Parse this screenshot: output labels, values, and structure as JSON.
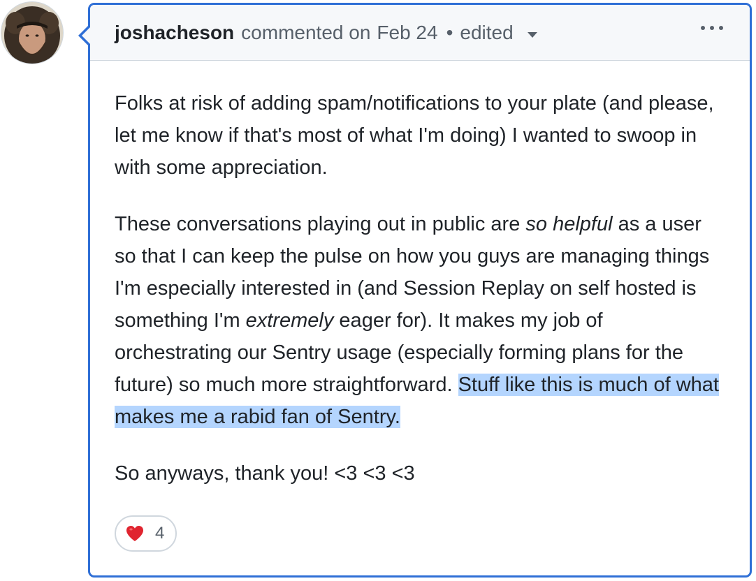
{
  "comment": {
    "author": "joshacheson",
    "action": "commented on",
    "date": "Feb 24",
    "separator": "•",
    "edited_label": "edited",
    "avatar_icon": "user-avatar",
    "menu_icon": "kebab-horizontal-icon",
    "paragraphs": {
      "p1": "Folks at risk of adding spam/notifications to your plate (and please, let me know if that's most of what I'm doing) I wanted to swoop in with some appreciation.",
      "p2_a": "These conversations playing out in public are ",
      "p2_b": "so helpful",
      "p2_c": " as a user so that I can keep the pulse on how you guys are managing things I'm especially interested in (and Session Replay on self hosted is something I'm ",
      "p2_d": "extremely",
      "p2_e": " eager for). It makes my job of orchestrating our Sentry usage (especially forming plans for the future) so much more straightforward. ",
      "p2_highlight": "Stuff like this is much of what makes me a rabid fan of Sentry.",
      "p3": "So anyways, thank you! <3 <3 <3"
    },
    "reaction": {
      "emoji_icon": "heart-icon",
      "count": "4"
    },
    "colors": {
      "card_border": "#2f6fd6",
      "header_bg": "#f6f8fa",
      "highlight": "#b4d5fe",
      "heart": "#e0242f"
    }
  }
}
